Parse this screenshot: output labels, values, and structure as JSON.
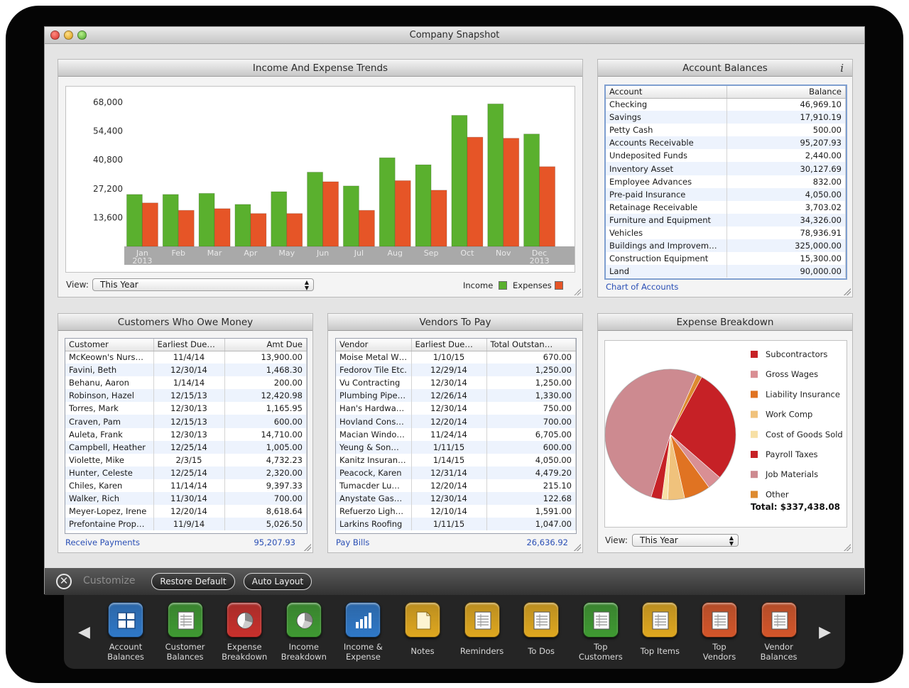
{
  "window": {
    "title": "Company Snapshot"
  },
  "colors": {
    "income": "#5ab02e",
    "expenses": "#e65527",
    "link": "#2a4fb5",
    "dock_blue": "#2f78c8",
    "dock_green": "#3f9a32",
    "dock_red": "#c9302c",
    "dock_yellow": "#e0a81f",
    "dock_orange": "#d5562a"
  },
  "income_expense": {
    "title": "Income And Expense Trends",
    "view_label": "View:",
    "view_value": "This Year",
    "legend_income": "Income",
    "legend_expenses": "Expenses"
  },
  "chart_data": [
    {
      "type": "bar",
      "title": "Income And Expense Trends",
      "categories": [
        "Jan 2013",
        "Feb",
        "Mar",
        "Apr",
        "May",
        "Jun",
        "Jul",
        "Aug",
        "Sep",
        "Oct",
        "Nov",
        "Dec 2013"
      ],
      "category_lines": [
        [
          "Jan",
          "2013"
        ],
        [
          "Feb"
        ],
        [
          "Mar"
        ],
        [
          "Apr"
        ],
        [
          "May"
        ],
        [
          "Jun"
        ],
        [
          "Jul"
        ],
        [
          "Aug"
        ],
        [
          "Sep"
        ],
        [
          "Oct"
        ],
        [
          "Nov"
        ],
        [
          "Dec",
          "2013"
        ]
      ],
      "yticks": [
        13600,
        27200,
        40800,
        54400,
        68000
      ],
      "ytick_labels": [
        "13,600",
        "27,200",
        "40,800",
        "54,400",
        "68,000"
      ],
      "ylim": [
        0,
        72000
      ],
      "grid": false,
      "legend": "bottom-right",
      "series": [
        {
          "name": "Income",
          "color": "#5ab02e",
          "values": [
            24500,
            24500,
            25000,
            19800,
            25800,
            35000,
            28500,
            41800,
            38500,
            61800,
            67200,
            53000
          ]
        },
        {
          "name": "Expenses",
          "color": "#e65527",
          "values": [
            20500,
            17000,
            17800,
            15500,
            15500,
            30500,
            17000,
            31000,
            26500,
            51500,
            51000,
            37600
          ]
        }
      ]
    },
    {
      "type": "pie",
      "title": "Expense Breakdown",
      "series": [
        {
          "name": "Subcontractors",
          "color": "#c62126",
          "value": 96000
        },
        {
          "name": "Gross Wages",
          "color": "#d98f94",
          "value": 12000
        },
        {
          "name": "Liability Insurance",
          "color": "#e07322",
          "value": 22000
        },
        {
          "name": "Work Comp",
          "color": "#f0c27c",
          "value": 14000
        },
        {
          "name": "Cost of Goods Sold",
          "color": "#f7e0a6",
          "value": 5000
        },
        {
          "name": "Payroll Taxes",
          "color": "#c62126",
          "value": 9000
        },
        {
          "name": "Job Materials",
          "color": "#cd8a90",
          "value": 175000
        },
        {
          "name": "Other",
          "color": "#dd8a30",
          "value": 4438
        }
      ],
      "total_label": "Total: $337,438.08"
    }
  ],
  "account_balances": {
    "title": "Account Balances",
    "info_glyph": "i",
    "col_account": "Account",
    "col_balance": "Balance",
    "rows": [
      [
        "Checking",
        "46,969.10"
      ],
      [
        "Savings",
        "17,910.19"
      ],
      [
        "Petty Cash",
        "500.00"
      ],
      [
        "Accounts Receivable",
        "95,207.93"
      ],
      [
        "Undeposited Funds",
        "2,440.00"
      ],
      [
        "Inventory Asset",
        "30,127.69"
      ],
      [
        "Employee Advances",
        "832.00"
      ],
      [
        "Pre-paid Insurance",
        "4,050.00"
      ],
      [
        "Retainage Receivable",
        "3,703.02"
      ],
      [
        "Furniture and Equipment",
        "34,326.00"
      ],
      [
        "Vehicles",
        "78,936.91"
      ],
      [
        "Buildings and Improvem…",
        "325,000.00"
      ],
      [
        "Construction Equipment",
        "15,300.00"
      ],
      [
        "Land",
        "90,000.00"
      ]
    ],
    "link": "Chart of Accounts"
  },
  "customers": {
    "title": "Customers Who Owe Money",
    "col_customer": "Customer",
    "col_due": "Earliest Due…",
    "col_amt": "Amt Due",
    "rows": [
      [
        "McKeown's Nurs…",
        "11/4/14",
        "13,900.00"
      ],
      [
        "Favini, Beth",
        "12/30/14",
        "1,468.30"
      ],
      [
        "Behanu, Aaron",
        "1/14/14",
        "200.00"
      ],
      [
        "Robinson, Hazel",
        "12/15/13",
        "12,420.98"
      ],
      [
        "Torres, Mark",
        "12/30/13",
        "1,165.95"
      ],
      [
        "Craven, Pam",
        "12/15/13",
        "600.00"
      ],
      [
        "Auleta, Frank",
        "12/30/13",
        "14,710.00"
      ],
      [
        "Campbell, Heather",
        "12/25/14",
        "1,005.00"
      ],
      [
        "Violette, Mike",
        "2/3/15",
        "4,732.23"
      ],
      [
        "Hunter, Celeste",
        "12/25/14",
        "2,320.00"
      ],
      [
        "Chiles, Karen",
        "11/14/14",
        "9,397.33"
      ],
      [
        "Walker, Rich",
        "11/30/14",
        "700.00"
      ],
      [
        "Meyer-Lopez, Irene",
        "12/20/14",
        "8,618.64"
      ],
      [
        "Prefontaine Prop…",
        "11/9/14",
        "5,026.50"
      ]
    ],
    "link": "Receive Payments",
    "total": "95,207.93"
  },
  "vendors": {
    "title": "Vendors To Pay",
    "col_vendor": "Vendor",
    "col_due": "Earliest Due…",
    "col_total": "Total Outstan…",
    "rows": [
      [
        "Moise Metal W…",
        "1/10/15",
        "670.00"
      ],
      [
        "Fedorov Tile Etc.",
        "12/29/14",
        "1,250.00"
      ],
      [
        "Vu Contracting",
        "12/30/14",
        "1,250.00"
      ],
      [
        "Plumbing Pipe…",
        "12/26/14",
        "1,330.00"
      ],
      [
        "Han's Hardwa…",
        "12/30/14",
        "750.00"
      ],
      [
        "Hovland Cons…",
        "12/20/14",
        "700.00"
      ],
      [
        "Macian Windo…",
        "11/24/14",
        "6,705.00"
      ],
      [
        "Yeung & Son…",
        "1/11/15",
        "600.00"
      ],
      [
        "Kanitz Insuran…",
        "1/14/15",
        "4,050.00"
      ],
      [
        "Peacock, Karen",
        "12/31/14",
        "4,479.20"
      ],
      [
        "Tumacder Lu…",
        "12/20/14",
        "215.10"
      ],
      [
        "Anystate Gas…",
        "12/30/14",
        "122.68"
      ],
      [
        "Refuerzo Ligh…",
        "12/10/14",
        "1,591.00"
      ],
      [
        "Larkins Roofing",
        "1/11/15",
        "1,047.00"
      ]
    ],
    "link": "Pay Bills",
    "total": "26,636.92"
  },
  "expense_breakdown": {
    "title": "Expense Breakdown",
    "view_label": "View:",
    "view_value": "This Year"
  },
  "customize_bar": {
    "close_glyph": "✕",
    "label": "Customize",
    "restore": "Restore Default",
    "auto_layout": "Auto Layout"
  },
  "dock": {
    "left_arrow": "◀",
    "right_arrow": "▶",
    "items": [
      {
        "line1": "Account",
        "line2": "Balances",
        "icon": "grid-icon",
        "color": "#2f78c8"
      },
      {
        "line1": "Customer",
        "line2": "Balances",
        "icon": "ledger-icon",
        "color": "#3f9a32"
      },
      {
        "line1": "Expense",
        "line2": "Breakdown",
        "icon": "pie-icon",
        "color": "#c9302c"
      },
      {
        "line1": "Income",
        "line2": "Breakdown",
        "icon": "pie-icon",
        "color": "#3f9a32"
      },
      {
        "line1": "Income &",
        "line2": "Expense",
        "icon": "bar-chart-icon",
        "color": "#2f78c8"
      },
      {
        "line1": "Notes",
        "line2": "",
        "icon": "note-icon",
        "color": "#e0a81f"
      },
      {
        "line1": "Reminders",
        "line2": "",
        "icon": "ledger-icon",
        "color": "#e0a81f"
      },
      {
        "line1": "To Dos",
        "line2": "",
        "icon": "ledger-icon",
        "color": "#e0a81f"
      },
      {
        "line1": "Top",
        "line2": "Customers",
        "icon": "ledger-icon",
        "color": "#3f9a32"
      },
      {
        "line1": "Top Items",
        "line2": "",
        "icon": "ledger-icon",
        "color": "#e0a81f"
      },
      {
        "line1": "Top",
        "line2": "Vendors",
        "icon": "ledger-icon",
        "color": "#d5562a"
      },
      {
        "line1": "Vendor",
        "line2": "Balances",
        "icon": "ledger-icon",
        "color": "#d5562a"
      }
    ]
  }
}
